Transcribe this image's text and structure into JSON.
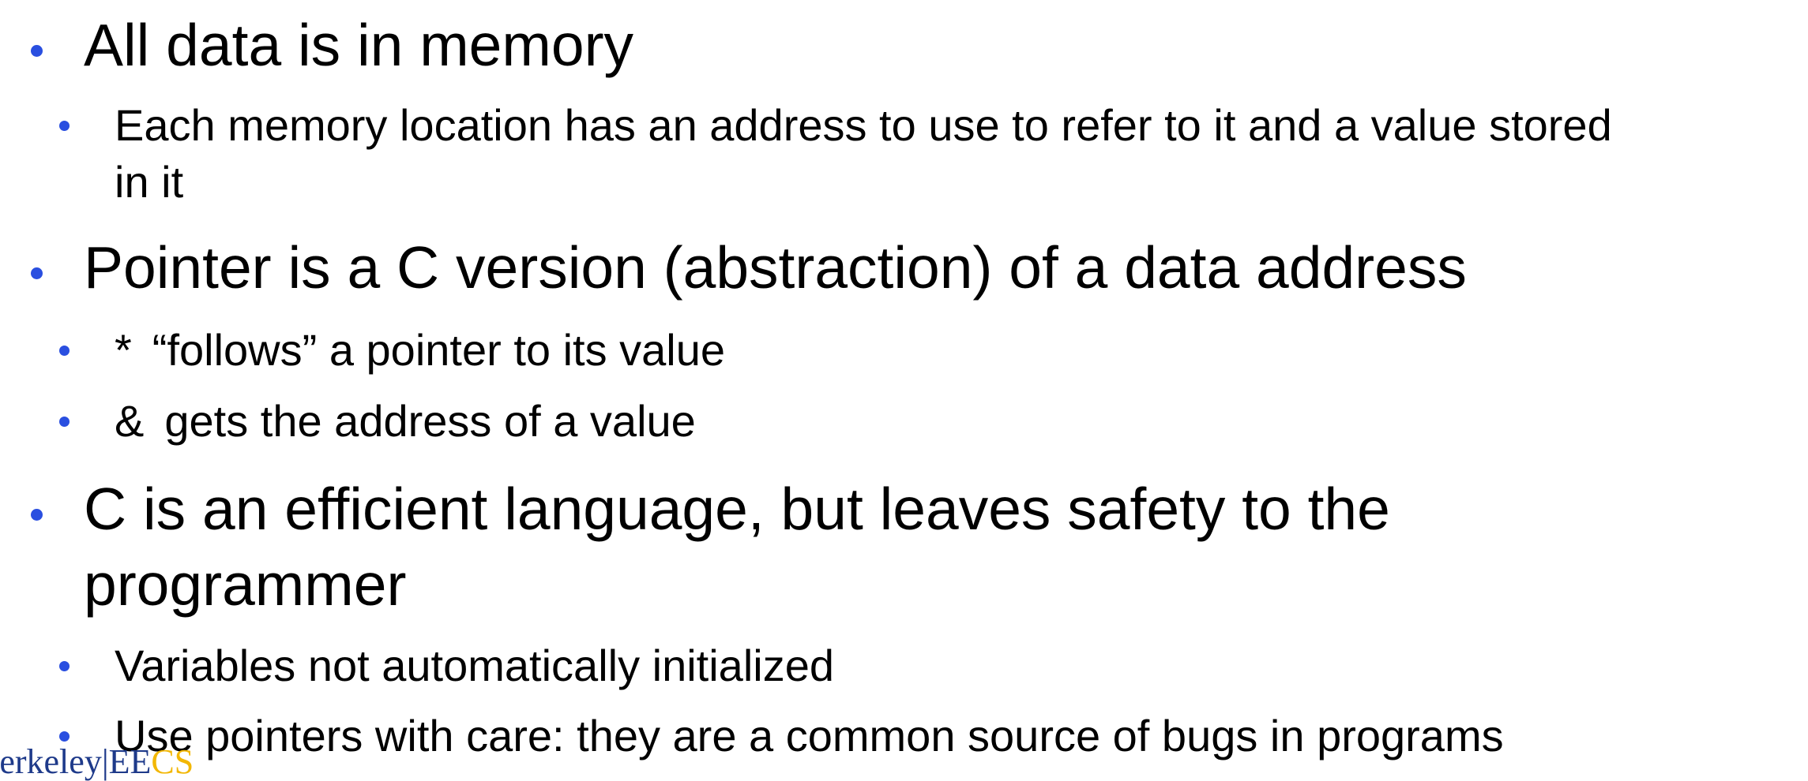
{
  "colors": {
    "bullet": "#2a4fe0",
    "text": "#000000",
    "logo_blue": "#1e3a8a",
    "logo_gold": "#f2b705"
  },
  "bullets": [
    {
      "text": "All data is in memory",
      "children": [
        {
          "line1": "Each memory location has an address to use to refer to it and a value stored",
          "line2": "in it"
        }
      ]
    },
    {
      "text": "Pointer is a C version (abstraction) of a data address",
      "children": [
        {
          "symbol": "*",
          "text": "“follows” a pointer to its value"
        },
        {
          "symbol": "&",
          "text": "gets the address of a value"
        }
      ]
    },
    {
      "line1": "C is an efficient language, but leaves safety to the",
      "line2": "programmer",
      "children": [
        {
          "text": "Variables not automatically initialized"
        },
        {
          "text": "Use pointers with care: they are a common source of bugs in programs"
        }
      ]
    }
  ],
  "logo": {
    "berkeley": "Berkeley",
    "separator": "|",
    "ee": "EE",
    "cs": "CS"
  }
}
